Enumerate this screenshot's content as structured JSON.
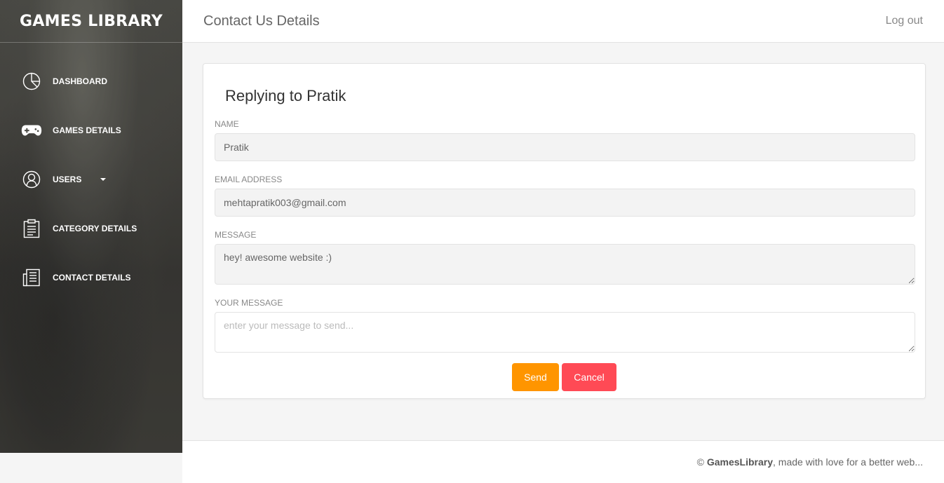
{
  "sidebar": {
    "brand": "GAMES LIBRARY",
    "items": [
      {
        "label": "DASHBOARD",
        "icon": "pie-chart-icon"
      },
      {
        "label": "GAMES DETAILS",
        "icon": "gamepad-icon"
      },
      {
        "label": "USERS",
        "icon": "user-icon",
        "has_dropdown": true
      },
      {
        "label": "CATEGORY DETAILS",
        "icon": "clipboard-icon"
      },
      {
        "label": "CONTACT DETAILS",
        "icon": "document-icon"
      }
    ]
  },
  "header": {
    "title": "Contact Us Details",
    "logout_label": "Log out"
  },
  "form": {
    "title": "Replying to Pratik",
    "name_label": "NAME",
    "name_value": "Pratik",
    "email_label": "EMAIL ADDRESS",
    "email_value": "mehtapratik003@gmail.com",
    "message_label": "MESSAGE",
    "message_value": "hey! awesome website :)",
    "your_message_label": "YOUR MESSAGE",
    "your_message_placeholder": "enter your message to send...",
    "send_label": "Send",
    "cancel_label": "Cancel"
  },
  "footer": {
    "copyright": "©",
    "brand": "GamesLibrary",
    "text": ", made with love for a better web..."
  },
  "colors": {
    "send_button": "#ff9500",
    "cancel_button": "#ff4a55"
  }
}
